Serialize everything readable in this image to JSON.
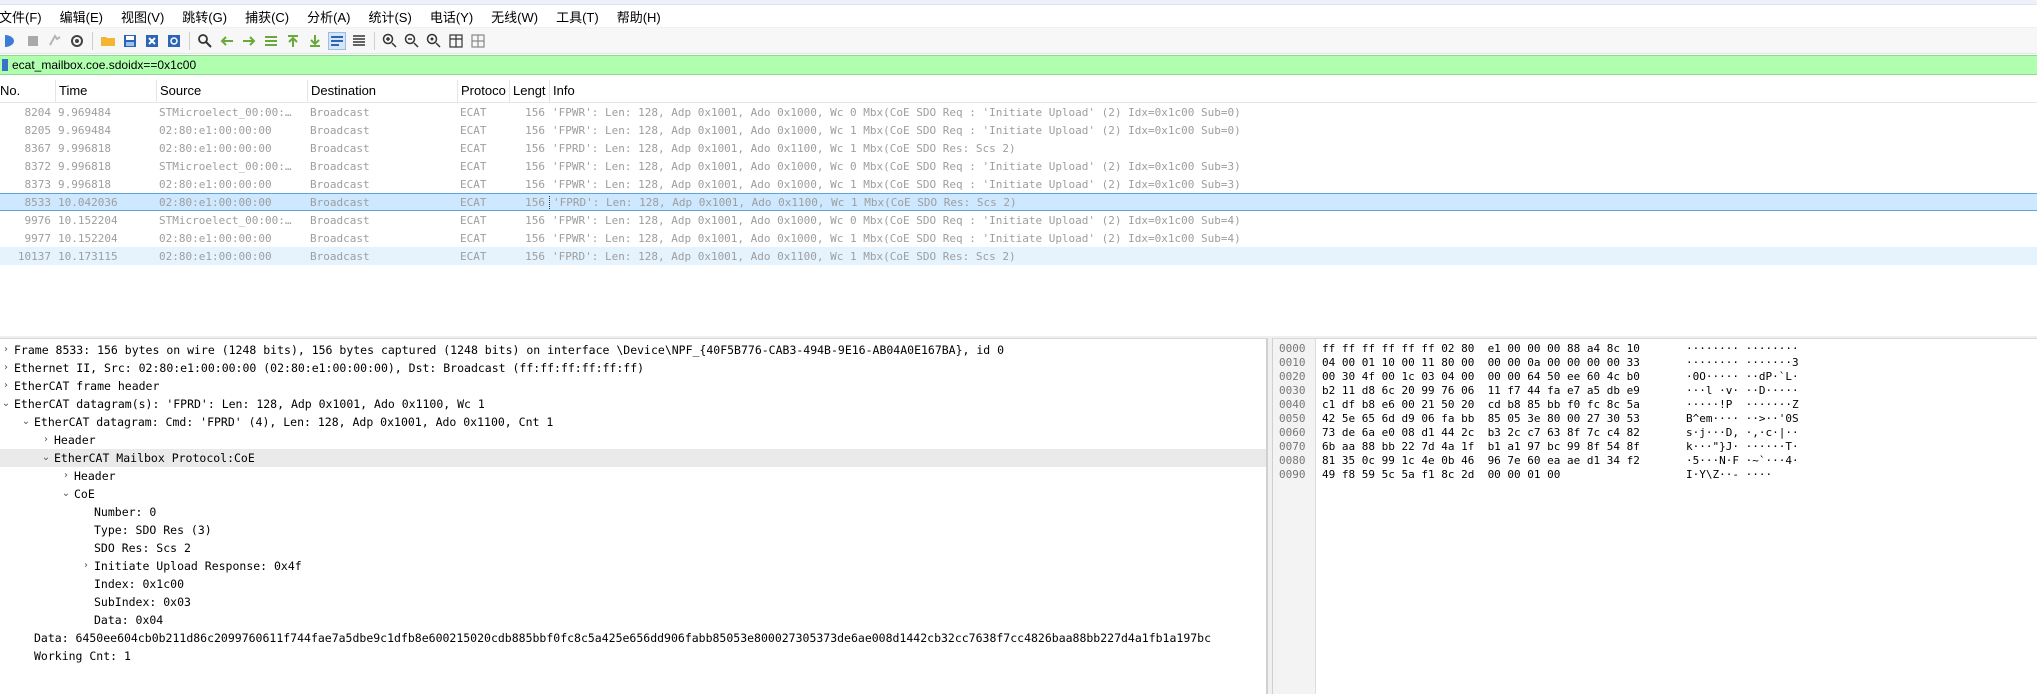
{
  "menu": [
    "文件(F)",
    "编辑(E)",
    "视图(V)",
    "跳转(G)",
    "捕获(C)",
    "分析(A)",
    "统计(S)",
    "电话(Y)",
    "无线(W)",
    "工具(T)",
    "帮助(H)"
  ],
  "filter": {
    "value": "ecat_mailbox.coe.sdoidx==0x1c00"
  },
  "columns": {
    "no": "No.",
    "time": "Time",
    "source": "Source",
    "destination": "Destination",
    "protocol": "Protoco",
    "length": "Lengt",
    "info": "Info"
  },
  "packets": [
    {
      "no": "8204",
      "time": "9.969484",
      "source": "STMicroelect_00:00:…",
      "destination": "Broadcast",
      "protocol": "ECAT",
      "length": "156",
      "info": "'FPWR': Len: 128, Adp 0x1001, Ado 0x1000, Wc 0  Mbx(CoE SDO Req : 'Initiate Upload' (2) Idx=0x1c00 Sub=0)"
    },
    {
      "no": "8205",
      "time": "9.969484",
      "source": "02:80:e1:00:00:00",
      "destination": "Broadcast",
      "protocol": "ECAT",
      "length": "156",
      "info": "'FPWR': Len: 128, Adp 0x1001, Ado 0x1000, Wc 1  Mbx(CoE SDO Req : 'Initiate Upload' (2) Idx=0x1c00 Sub=0)"
    },
    {
      "no": "8367",
      "time": "9.996818",
      "source": "02:80:e1:00:00:00",
      "destination": "Broadcast",
      "protocol": "ECAT",
      "length": "156",
      "info": "'FPRD': Len: 128, Adp 0x1001, Ado 0x1100, Wc 1  Mbx(CoE SDO Res: Scs 2)"
    },
    {
      "no": "8372",
      "time": "9.996818",
      "source": "STMicroelect_00:00:…",
      "destination": "Broadcast",
      "protocol": "ECAT",
      "length": "156",
      "info": "'FPWR': Len: 128, Adp 0x1001, Ado 0x1000, Wc 0  Mbx(CoE SDO Req : 'Initiate Upload' (2) Idx=0x1c00 Sub=3)"
    },
    {
      "no": "8373",
      "time": "9.996818",
      "source": "02:80:e1:00:00:00",
      "destination": "Broadcast",
      "protocol": "ECAT",
      "length": "156",
      "info": "'FPWR': Len: 128, Adp 0x1001, Ado 0x1000, Wc 1  Mbx(CoE SDO Req : 'Initiate Upload' (2) Idx=0x1c00 Sub=3)"
    },
    {
      "no": "8533",
      "time": "10.042036",
      "source": "02:80:e1:00:00:00",
      "destination": "Broadcast",
      "protocol": "ECAT",
      "length": "156",
      "info": "'FPRD': Len: 128, Adp 0x1001, Ado 0x1100, Wc 1  Mbx(CoE SDO Res: Scs 2)"
    },
    {
      "no": "9976",
      "time": "10.152204",
      "source": "STMicroelect_00:00:…",
      "destination": "Broadcast",
      "protocol": "ECAT",
      "length": "156",
      "info": "'FPWR': Len: 128, Adp 0x1001, Ado 0x1000, Wc 0  Mbx(CoE SDO Req : 'Initiate Upload' (2) Idx=0x1c00 Sub=4)"
    },
    {
      "no": "9977",
      "time": "10.152204",
      "source": "02:80:e1:00:00:00",
      "destination": "Broadcast",
      "protocol": "ECAT",
      "length": "156",
      "info": "'FPWR': Len: 128, Adp 0x1001, Ado 0x1000, Wc 1  Mbx(CoE SDO Req : 'Initiate Upload' (2) Idx=0x1c00 Sub=4)"
    },
    {
      "no": "10137",
      "time": "10.173115",
      "source": "02:80:e1:00:00:00",
      "destination": "Broadcast",
      "protocol": "ECAT",
      "length": "156",
      "info": "'FPRD': Len: 128, Adp 0x1001, Ado 0x1100, Wc 1  Mbx(CoE SDO Res: Scs 2)"
    }
  ],
  "details": [
    {
      "arrow": ">",
      "text": "Frame 8533: 156 bytes on wire (1248 bits), 156 bytes captured (1248 bits) on interface \\Device\\NPF_{40F5B776-CAB3-494B-9E16-AB04A0E167BA}, id 0"
    },
    {
      "arrow": ">",
      "text": "Ethernet II, Src: 02:80:e1:00:00:00 (02:80:e1:00:00:00), Dst: Broadcast (ff:ff:ff:ff:ff:ff)"
    },
    {
      "arrow": ">",
      "text": "EtherCAT frame header"
    },
    {
      "arrow": "v",
      "text": "EtherCAT datagram(s): 'FPRD': Len: 128, Adp 0x1001, Ado 0x1100, Wc 1"
    },
    {
      "arrow": "v",
      "text": "EtherCAT datagram: Cmd: 'FPRD' (4), Len: 128, Adp 0x1001, Ado 0x1100, Cnt 1"
    },
    {
      "arrow": ">",
      "text": "Header"
    },
    {
      "arrow": "v",
      "text": "EtherCAT Mailbox Protocol:CoE"
    },
    {
      "arrow": ">",
      "text": "Header"
    },
    {
      "arrow": "v",
      "text": "CoE"
    },
    {
      "arrow": "",
      "text": "Number: 0"
    },
    {
      "arrow": "",
      "text": "Type: SDO Res (3)"
    },
    {
      "arrow": "",
      "text": "SDO Res: Scs 2"
    },
    {
      "arrow": ">",
      "text": "Initiate Upload Response: 0x4f"
    },
    {
      "arrow": "",
      "text": "Index: 0x1c00"
    },
    {
      "arrow": "",
      "text": "SubIndex: 0x03"
    },
    {
      "arrow": "",
      "text": "Data: 0x04"
    },
    {
      "arrow": "",
      "text": "Data: 6450ee604cb0b211d86c2099760611f744fae7a5dbe9c1dfb8e600215020cdb885bbf0fc8c5a425e656dd906fabb85053e800027305373de6ae008d1442cb32cc7638f7cc4826baa88bb227d4a1fb1a197bc"
    },
    {
      "arrow": "",
      "text": "Working Cnt: 1"
    }
  ],
  "bytes": [
    {
      "offset": "0000",
      "hex": "ff ff ff ff ff ff 02 80  e1 00 00 00 88 a4 8c 10",
      "ascii": "········ ········"
    },
    {
      "offset": "0010",
      "hex": "04 00 01 10 00 11 80 00  00 00 0a 00 00 00 00 33",
      "ascii": "········ ·······3"
    },
    {
      "offset": "0020",
      "hex": "00 30 4f 00 1c 03 04 00  00 00 64 50 ee 60 4c b0",
      "ascii": "·0O····· ··dP·`L·"
    },
    {
      "offset": "0030",
      "hex": "b2 11 d8 6c 20 99 76 06  11 f7 44 fa e7 a5 db e9",
      "ascii": "···l ·v· ··D·····"
    },
    {
      "offset": "0040",
      "hex": "c1 df b8 e6 00 21 50 20  cd b8 85 bb f0 fc 8c 5a",
      "ascii": "·····!P  ·······Z"
    },
    {
      "offset": "0050",
      "hex": "42 5e 65 6d d9 06 fa bb  85 05 3e 80 00 27 30 53",
      "ascii": "B^em···· ··>··'0S"
    },
    {
      "offset": "0060",
      "hex": "73 de 6a e0 08 d1 44 2c  b3 2c c7 63 8f 7c c4 82",
      "ascii": "s·j···D, ·,·c·|··"
    },
    {
      "offset": "0070",
      "hex": "6b aa 88 bb 22 7d 4a 1f  b1 a1 97 bc 99 8f 54 8f",
      "ascii": "k···\"}J· ······T·"
    },
    {
      "offset": "0080",
      "hex": "81 35 0c 99 1c 4e 0b 46  96 7e 60 ea ae d1 34 f2",
      "ascii": "·5···N·F ·~`···4·"
    },
    {
      "offset": "0090",
      "hex": "49 f8 59 5c 5a f1 8c 2d  00 00 01 00",
      "ascii": "I·Y\\Z··- ····"
    }
  ],
  "colors": {
    "filter_bg": "#afffaf",
    "selected_row": "#cde8ff",
    "hover_row": "#e5f3ff",
    "dim_text": "#9e9e9e"
  }
}
